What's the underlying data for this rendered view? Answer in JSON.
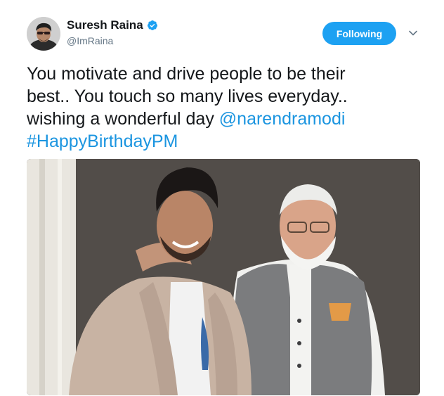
{
  "tweet": {
    "author": {
      "name": "Suresh Raina",
      "handle": "@ImRaina",
      "verified": true
    },
    "follow_button_label": "Following",
    "text_lines": [
      "You motivate and drive people to be their",
      "best.. You touch so many lives everyday..",
      "wishing a wonderful day "
    ],
    "mention": "@narendramodi",
    "hashtag": "#HappyBirthdayPM",
    "icons": {
      "verified": "verified-badge-icon",
      "more": "chevron-down-icon"
    },
    "colors": {
      "accent": "#1da1f2",
      "link": "#1b95e0",
      "handle": "#657786"
    }
  }
}
